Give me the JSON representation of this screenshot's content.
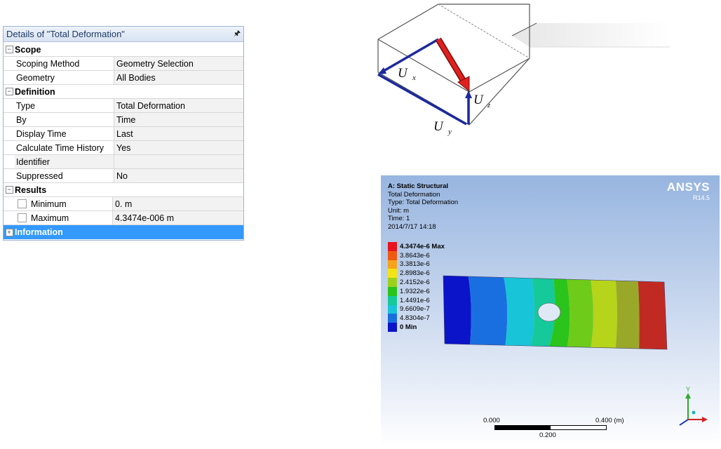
{
  "details": {
    "title": "Details of \"Total Deformation\"",
    "rows": [
      {
        "kind": "group",
        "toggle": "−",
        "label": "Scope"
      },
      {
        "kind": "prop",
        "label": "Scoping Method",
        "value": "Geometry Selection"
      },
      {
        "kind": "prop",
        "label": "Geometry",
        "value": "All Bodies"
      },
      {
        "kind": "group",
        "toggle": "−",
        "label": "Definition"
      },
      {
        "kind": "prop",
        "label": "Type",
        "value": "Total Deformation"
      },
      {
        "kind": "prop",
        "label": "By",
        "value": "Time"
      },
      {
        "kind": "prop",
        "label": "Display Time",
        "value": "Last"
      },
      {
        "kind": "prop",
        "label": "Calculate Time History",
        "value": "Yes"
      },
      {
        "kind": "prop",
        "label": "Identifier",
        "value": ""
      },
      {
        "kind": "prop",
        "label": "Suppressed",
        "value": "No"
      },
      {
        "kind": "group",
        "toggle": "−",
        "label": "Results"
      },
      {
        "kind": "check",
        "label": "Minimum",
        "value": "0. m"
      },
      {
        "kind": "check",
        "label": "Maximum",
        "value": "4.3474e-006 m"
      },
      {
        "kind": "info",
        "toggle": "+",
        "label": "Information"
      }
    ]
  },
  "diagram": {
    "ux_label": "U",
    "ux_sub": "x",
    "uy_label": "U",
    "uy_sub": "y",
    "uz_label": "U",
    "uz_sub": "z"
  },
  "viewport": {
    "analysis": "A: Static Structural",
    "result": "Total Deformation",
    "type": "Type: Total Deformation",
    "unit": "Unit: m",
    "time": "Time: 1",
    "date": "2014/7/17 14:18",
    "brand": "ANSYS",
    "version": "R14.5",
    "legend": [
      {
        "label": "4.3474e-6 Max",
        "color": "#e8141c",
        "bold": true
      },
      {
        "label": "3.8643e-6",
        "color": "#ef5a12",
        "bold": false
      },
      {
        "label": "3.3813e-6",
        "color": "#f7a41a",
        "bold": false
      },
      {
        "label": "2.8983e-6",
        "color": "#f2e414",
        "bold": false
      },
      {
        "label": "2.4152e-6",
        "color": "#9bd11a",
        "bold": false
      },
      {
        "label": "1.9322e-6",
        "color": "#2ac41c",
        "bold": false
      },
      {
        "label": "1.4491e-6",
        "color": "#16c99a",
        "bold": false
      },
      {
        "label": "9.6609e-7",
        "color": "#18c4d8",
        "bold": false
      },
      {
        "label": "4.8304e-7",
        "color": "#1a6fe0",
        "bold": false
      },
      {
        "label": "0 Min",
        "color": "#0b14c8",
        "bold": true
      }
    ],
    "scale_left": "0.000",
    "scale_right": "0.400 (m)",
    "scale_mid": "0.200",
    "triad_y": "Y"
  }
}
